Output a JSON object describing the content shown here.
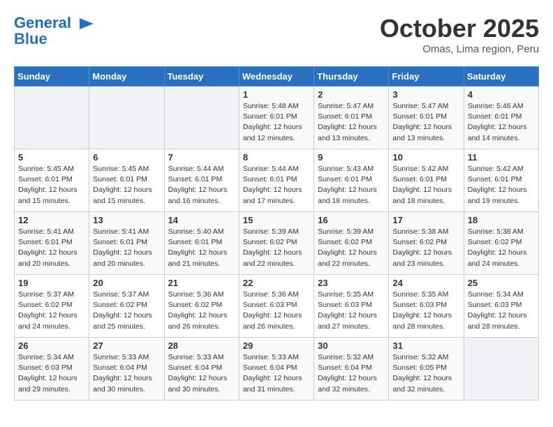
{
  "header": {
    "logo_line1": "General",
    "logo_line2": "Blue",
    "month": "October 2025",
    "location": "Omas, Lima region, Peru"
  },
  "weekdays": [
    "Sunday",
    "Monday",
    "Tuesday",
    "Wednesday",
    "Thursday",
    "Friday",
    "Saturday"
  ],
  "weeks": [
    [
      {
        "day": "",
        "info": ""
      },
      {
        "day": "",
        "info": ""
      },
      {
        "day": "",
        "info": ""
      },
      {
        "day": "1",
        "info": "Sunrise: 5:48 AM\nSunset: 6:01 PM\nDaylight: 12 hours\nand 12 minutes."
      },
      {
        "day": "2",
        "info": "Sunrise: 5:47 AM\nSunset: 6:01 PM\nDaylight: 12 hours\nand 13 minutes."
      },
      {
        "day": "3",
        "info": "Sunrise: 5:47 AM\nSunset: 6:01 PM\nDaylight: 12 hours\nand 13 minutes."
      },
      {
        "day": "4",
        "info": "Sunrise: 5:46 AM\nSunset: 6:01 PM\nDaylight: 12 hours\nand 14 minutes."
      }
    ],
    [
      {
        "day": "5",
        "info": "Sunrise: 5:45 AM\nSunset: 6:01 PM\nDaylight: 12 hours\nand 15 minutes."
      },
      {
        "day": "6",
        "info": "Sunrise: 5:45 AM\nSunset: 6:01 PM\nDaylight: 12 hours\nand 15 minutes."
      },
      {
        "day": "7",
        "info": "Sunrise: 5:44 AM\nSunset: 6:01 PM\nDaylight: 12 hours\nand 16 minutes."
      },
      {
        "day": "8",
        "info": "Sunrise: 5:44 AM\nSunset: 6:01 PM\nDaylight: 12 hours\nand 17 minutes."
      },
      {
        "day": "9",
        "info": "Sunrise: 5:43 AM\nSunset: 6:01 PM\nDaylight: 12 hours\nand 18 minutes."
      },
      {
        "day": "10",
        "info": "Sunrise: 5:42 AM\nSunset: 6:01 PM\nDaylight: 12 hours\nand 18 minutes."
      },
      {
        "day": "11",
        "info": "Sunrise: 5:42 AM\nSunset: 6:01 PM\nDaylight: 12 hours\nand 19 minutes."
      }
    ],
    [
      {
        "day": "12",
        "info": "Sunrise: 5:41 AM\nSunset: 6:01 PM\nDaylight: 12 hours\nand 20 minutes."
      },
      {
        "day": "13",
        "info": "Sunrise: 5:41 AM\nSunset: 6:01 PM\nDaylight: 12 hours\nand 20 minutes."
      },
      {
        "day": "14",
        "info": "Sunrise: 5:40 AM\nSunset: 6:01 PM\nDaylight: 12 hours\nand 21 minutes."
      },
      {
        "day": "15",
        "info": "Sunrise: 5:39 AM\nSunset: 6:02 PM\nDaylight: 12 hours\nand 22 minutes."
      },
      {
        "day": "16",
        "info": "Sunrise: 5:39 AM\nSunset: 6:02 PM\nDaylight: 12 hours\nand 22 minutes."
      },
      {
        "day": "17",
        "info": "Sunrise: 5:38 AM\nSunset: 6:02 PM\nDaylight: 12 hours\nand 23 minutes."
      },
      {
        "day": "18",
        "info": "Sunrise: 5:38 AM\nSunset: 6:02 PM\nDaylight: 12 hours\nand 24 minutes."
      }
    ],
    [
      {
        "day": "19",
        "info": "Sunrise: 5:37 AM\nSunset: 6:02 PM\nDaylight: 12 hours\nand 24 minutes."
      },
      {
        "day": "20",
        "info": "Sunrise: 5:37 AM\nSunset: 6:02 PM\nDaylight: 12 hours\nand 25 minutes."
      },
      {
        "day": "21",
        "info": "Sunrise: 5:36 AM\nSunset: 6:02 PM\nDaylight: 12 hours\nand 26 minutes."
      },
      {
        "day": "22",
        "info": "Sunrise: 5:36 AM\nSunset: 6:03 PM\nDaylight: 12 hours\nand 26 minutes."
      },
      {
        "day": "23",
        "info": "Sunrise: 5:35 AM\nSunset: 6:03 PM\nDaylight: 12 hours\nand 27 minutes."
      },
      {
        "day": "24",
        "info": "Sunrise: 5:35 AM\nSunset: 6:03 PM\nDaylight: 12 hours\nand 28 minutes."
      },
      {
        "day": "25",
        "info": "Sunrise: 5:34 AM\nSunset: 6:03 PM\nDaylight: 12 hours\nand 28 minutes."
      }
    ],
    [
      {
        "day": "26",
        "info": "Sunrise: 5:34 AM\nSunset: 6:03 PM\nDaylight: 12 hours\nand 29 minutes."
      },
      {
        "day": "27",
        "info": "Sunrise: 5:33 AM\nSunset: 6:04 PM\nDaylight: 12 hours\nand 30 minutes."
      },
      {
        "day": "28",
        "info": "Sunrise: 5:33 AM\nSunset: 6:04 PM\nDaylight: 12 hours\nand 30 minutes."
      },
      {
        "day": "29",
        "info": "Sunrise: 5:33 AM\nSunset: 6:04 PM\nDaylight: 12 hours\nand 31 minutes."
      },
      {
        "day": "30",
        "info": "Sunrise: 5:32 AM\nSunset: 6:04 PM\nDaylight: 12 hours\nand 32 minutes."
      },
      {
        "day": "31",
        "info": "Sunrise: 5:32 AM\nSunset: 6:05 PM\nDaylight: 12 hours\nand 32 minutes."
      },
      {
        "day": "",
        "info": ""
      }
    ]
  ]
}
